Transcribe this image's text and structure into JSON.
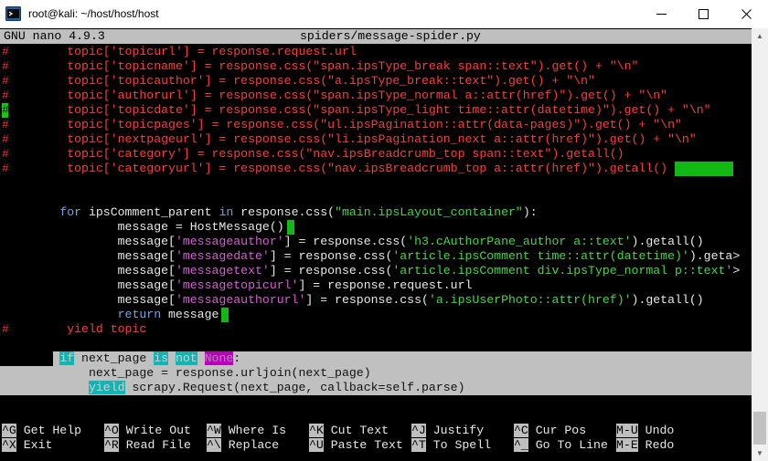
{
  "window": {
    "title": "root@kali: ~/host/host/host",
    "minimize": "—",
    "maximize": "☐",
    "close": "✕"
  },
  "nano": {
    "version": "GNU nano 4.9.3",
    "filename": "spiders/message-spider.py"
  },
  "code": {
    "lines": [
      {
        "prefix": "#",
        "text": "topic['topicurl'] = response.request.url"
      },
      {
        "prefix": "#",
        "text": "topic['topicname'] = response.css(\"span.ipsType_break span::text\").get() + \"\\n\""
      },
      {
        "prefix": "#",
        "text": "topic['topicauthor'] = response.css(\"a.ipsType_break::text\").get() + \"\\n\""
      },
      {
        "prefix": "#",
        "text": "topic['authorurl'] = response.css(\"span.ipsType_normal a::attr(href)\").get() + \"\\n\""
      },
      {
        "prefix": "#",
        "text": "topic['topicdate'] = response.css(\"span.ipsType_light time::attr(datetime)\").get() + \"\\n\""
      },
      {
        "prefix": "#",
        "text": "topic['topicpages'] = response.css(\"ul.ipsPagination::attr(data-pages)\").get() + \"\\n\""
      },
      {
        "prefix": "#",
        "text": "topic['nextpageurl'] = response.css(\"li.ipsPagination_next a::attr(href)\").get() + \"\\n\""
      },
      {
        "prefix": "#",
        "text": "topic['category'] = response.css(\"nav.ipsBreadcrumb_top span::text\").getall()"
      },
      {
        "prefix": "#",
        "text": "topic['categoryurl'] = response.css(\"nav.ipsBreadcrumb_top a::attr(href)\").getall()"
      }
    ],
    "for_kw": "for",
    "for_var": " ipsComment_parent ",
    "in_kw": "in",
    "for_rest": " response.css(",
    "for_str": "\"main.ipsLayout_container\"",
    "for_end": "):",
    "msg_init": "message = HostMessage()",
    "msg_lines": [
      {
        "pre": "message[",
        "key": "'messageauthor'",
        "mid": "] = response.css(",
        "arg": "'h3.cAuthorPane_author a::text'",
        "post": ").getall()"
      },
      {
        "pre": "message[",
        "key": "'messagedate'",
        "mid": "] = response.css(",
        "arg": "'article.ipsComment time::attr(datetime)'",
        "post": ").geta>"
      },
      {
        "pre": "message[",
        "key": "'messagetext'",
        "mid": "] = response.css(",
        "arg": "'article.ipsComment div.ipsType_normal p::text'",
        "post": ">"
      },
      {
        "pre": "message[",
        "key": "'messagetopicurl'",
        "mid": "] = response.request.url",
        "arg": "",
        "post": ""
      },
      {
        "pre": "message[",
        "key": "'messageauthorurl'",
        "mid": "] = response.css(",
        "arg": "'a.ipsUserPhoto::attr(href)'",
        "post": ").getall()"
      }
    ],
    "return_kw": "return",
    "return_rest": " message",
    "yield_comment_prefix": "#",
    "yield_topic": "yield topic",
    "if_kw": "if",
    "if_var": " next_page ",
    "is_kw": "is",
    "not_kw": "not",
    "none_kw": "None",
    "if_end": ":",
    "next_page_line": "next_page = response.urljoin(next_page)",
    "yield_kw": "yield",
    "yield_rest": " scrapy.Request(next_page, callback=self.parse)"
  },
  "shortcuts": [
    {
      "key": "^G",
      "label": " Get Help  "
    },
    {
      "key": "^O",
      "label": " Write Out "
    },
    {
      "key": "^W",
      "label": " Where Is  "
    },
    {
      "key": "^K",
      "label": " Cut Text  "
    },
    {
      "key": "^J",
      "label": " Justify   "
    },
    {
      "key": "^C",
      "label": " Cur Pos   "
    },
    {
      "key": "M-U",
      "label": " Undo"
    },
    {
      "key": "^X",
      "label": " Exit      "
    },
    {
      "key": "^R",
      "label": " Read File "
    },
    {
      "key": "^\\",
      "label": " Replace   "
    },
    {
      "key": "^U",
      "label": " Paste Text"
    },
    {
      "key": "^T",
      "label": " To Spell  "
    },
    {
      "key": "^_",
      "label": " Go To Line"
    },
    {
      "key": "M-E",
      "label": " Redo"
    }
  ],
  "colors": {
    "comment": "#ff3b3b",
    "keyword": "#6fa8dc",
    "string": "#44d844",
    "dict_key": "#d85cd8",
    "selection": "#c0c0c0"
  }
}
